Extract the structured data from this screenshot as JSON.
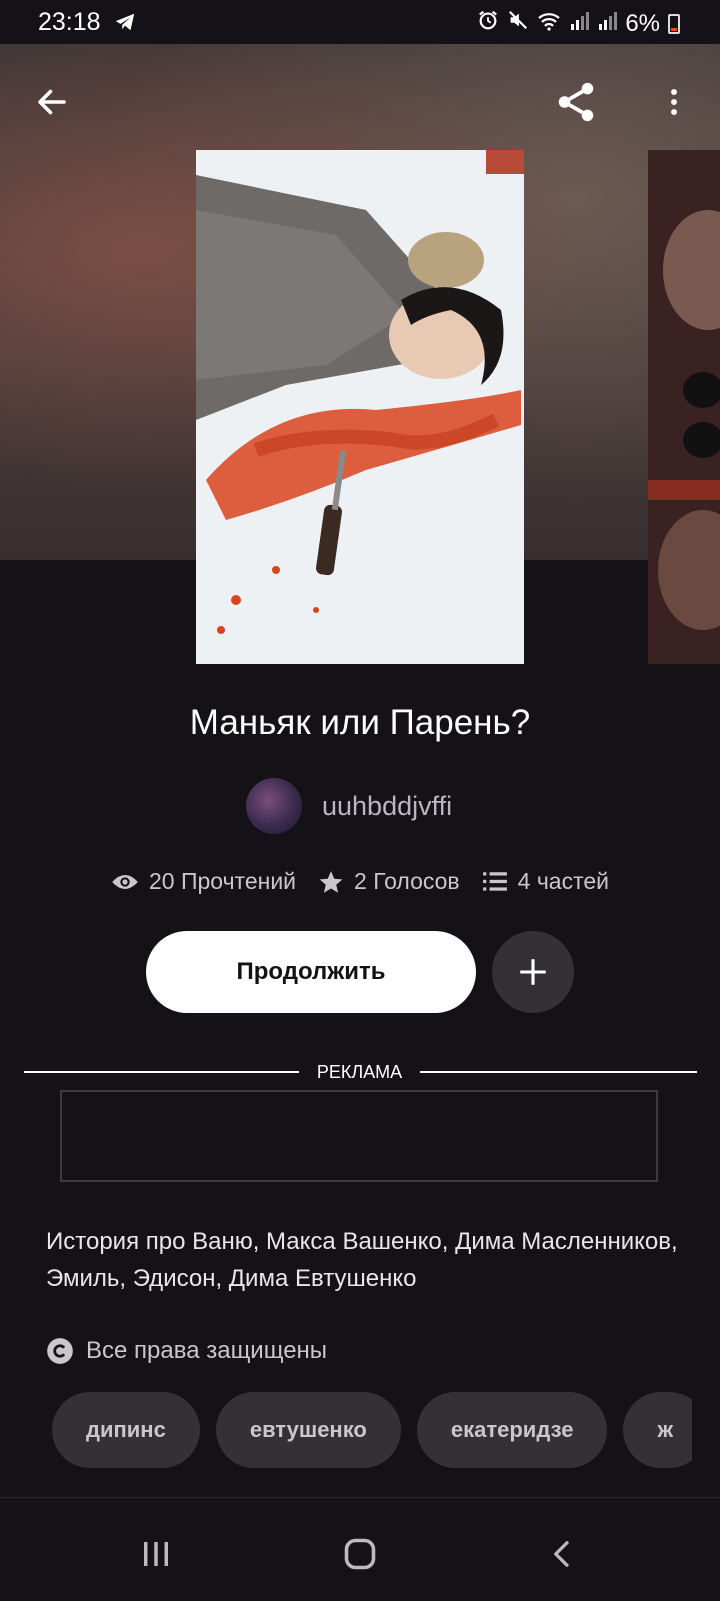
{
  "status_bar": {
    "time": "23:18",
    "battery": "6%",
    "icons": [
      "telegram-icon",
      "alarm-icon",
      "mute-icon",
      "wifi-icon",
      "signal-icon",
      "signal-icon",
      "battery-icon"
    ]
  },
  "top_bar": {
    "icons": [
      "back-arrow-icon",
      "share-icon",
      "more-vertical-icon"
    ]
  },
  "story": {
    "title": "Маньяк или Парень?",
    "author": "uuhbddjvffi",
    "stats": {
      "reads": "20 Прочтений",
      "votes": "2 Голосов",
      "parts": "4 частей"
    },
    "continue_label": "Продолжить",
    "description": "История про Ваню, Макса Вашенко, Дима Масленников,  Эмиль, Эдисон, Дима Евтушенко",
    "copyright": "Все права защищены",
    "tags": [
      "дипинс",
      "евтушенко",
      "екатеридзе",
      "ж"
    ]
  },
  "ad": {
    "label": "РЕКЛАМА"
  },
  "nav_bar": {
    "icons": [
      "recent-apps-icon",
      "home-icon",
      "back-icon"
    ]
  },
  "colors": {
    "background": "#141216",
    "button_primary": "#ffffff",
    "button_secondary": "#333136",
    "text_muted": "#c9c7cc"
  }
}
